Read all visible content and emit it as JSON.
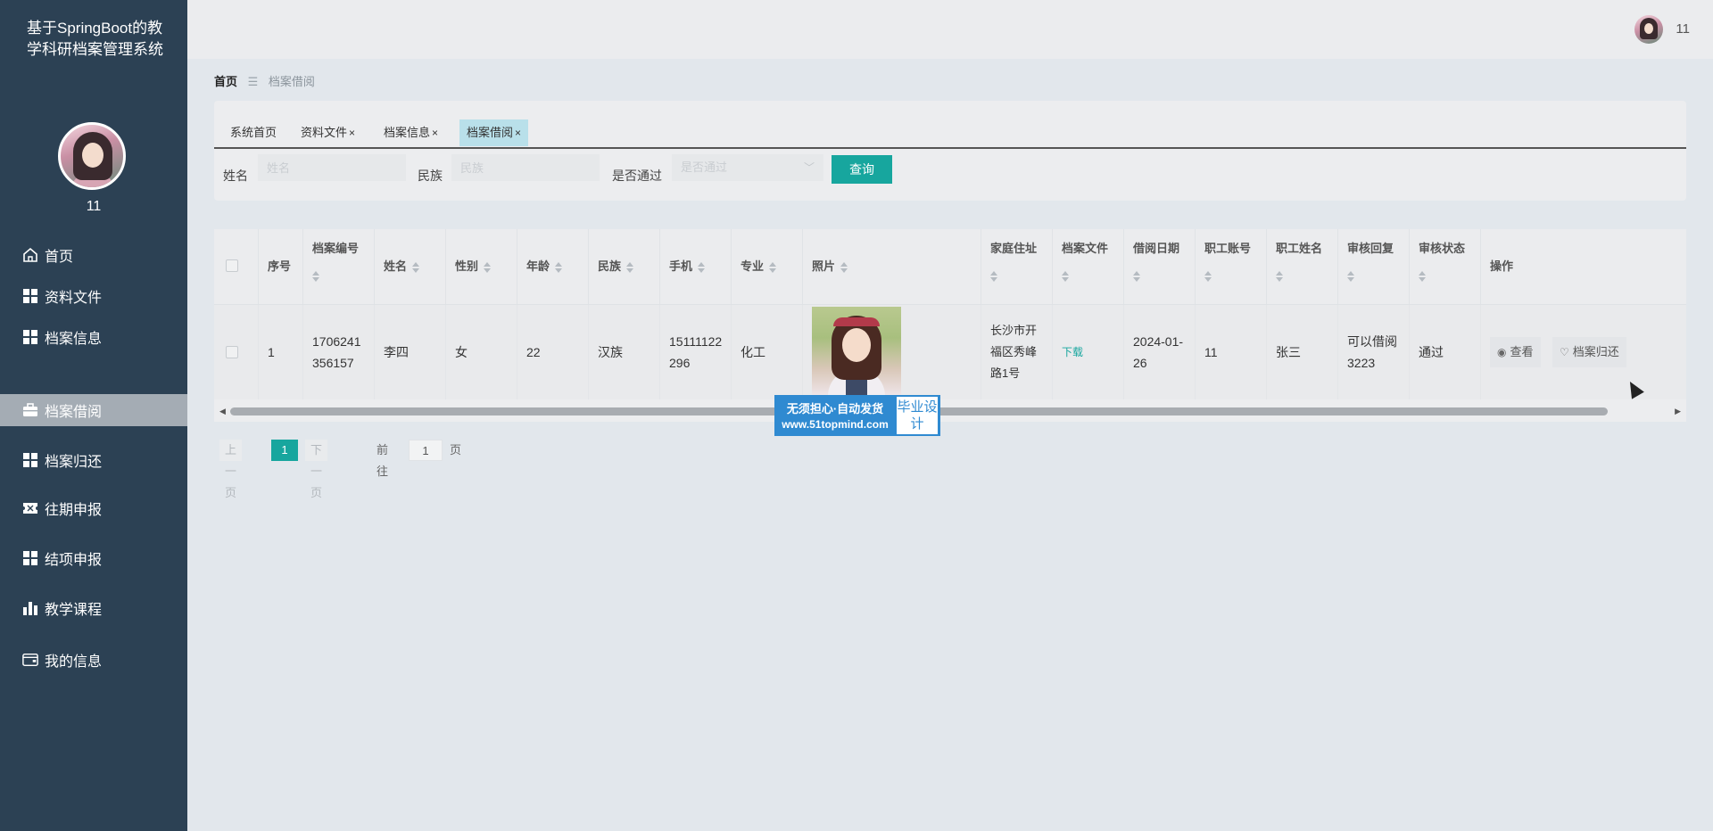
{
  "app": {
    "title": "基于SpringBoot的教学科研档案管理系统"
  },
  "user": {
    "name": "11"
  },
  "sidebar": {
    "items": [
      {
        "label": "首页",
        "icon": "home-icon"
      },
      {
        "label": "资料文件",
        "icon": "grid-icon"
      },
      {
        "label": "档案信息",
        "icon": "grid-icon"
      },
      {
        "label": "档案借阅",
        "icon": "briefcase-icon",
        "active": true
      },
      {
        "label": "档案归还",
        "icon": "grid-icon"
      },
      {
        "label": "往期申报",
        "icon": "ticket-icon"
      },
      {
        "label": "结项申报",
        "icon": "grid-icon"
      },
      {
        "label": "教学课程",
        "icon": "bar-chart-icon"
      },
      {
        "label": "我的信息",
        "icon": "wallet-icon"
      }
    ]
  },
  "breadcrumb": {
    "home": "首页",
    "current": "档案借阅"
  },
  "tabs": [
    {
      "label": "系统首页",
      "closable": false
    },
    {
      "label": "资料文件",
      "closable": true
    },
    {
      "label": "档案信息",
      "closable": true
    },
    {
      "label": "档案借阅",
      "closable": true,
      "active": true
    }
  ],
  "tab_close": "×",
  "search": {
    "name_label": "姓名",
    "name_placeholder": "姓名",
    "ethnic_label": "民族",
    "ethnic_placeholder": "民族",
    "passed_label": "是否通过",
    "passed_placeholder": "是否通过",
    "query_button": "查询"
  },
  "table": {
    "headers": {
      "index": "序号",
      "archive_no": "档案编号",
      "name": "姓名",
      "gender": "性别",
      "age": "年龄",
      "ethnic": "民族",
      "phone": "手机",
      "major": "专业",
      "photo": "照片",
      "address": "家庭住址",
      "archive_file": "档案文件",
      "borrow_date": "借阅日期",
      "staff_account": "职工账号",
      "staff_name": "职工姓名",
      "review_reply": "审核回复",
      "review_status": "审核状态",
      "actions": "操作"
    },
    "rows": [
      {
        "index": "1",
        "archive_no": "1706241356157",
        "name": "李四",
        "gender": "女",
        "age": "22",
        "ethnic": "汉族",
        "phone": "15111122296",
        "major": "化工",
        "address": "长沙市开福区秀峰路1号",
        "archive_file": "下载",
        "borrow_date": "2024-01-26",
        "staff_account": "11",
        "staff_name": "张三",
        "review_reply": "可以借阅3223",
        "review_status": "通过",
        "view_button": "查看",
        "return_button": "档案归还"
      }
    ]
  },
  "watermark": {
    "line1": "无须担心·自动发货",
    "line2": "www.51topmind.com",
    "badge": "毕业设计"
  },
  "pagination": {
    "prev": "上一页",
    "current_page": "1",
    "next": "下一页",
    "goto_label": "前往",
    "goto_value": "1",
    "page_suffix": "页"
  },
  "colors": {
    "sidebar": "#2c4154",
    "accent": "#17a69e",
    "active_tab": "#b9e0ea",
    "watermark": "#2f8ad1"
  }
}
